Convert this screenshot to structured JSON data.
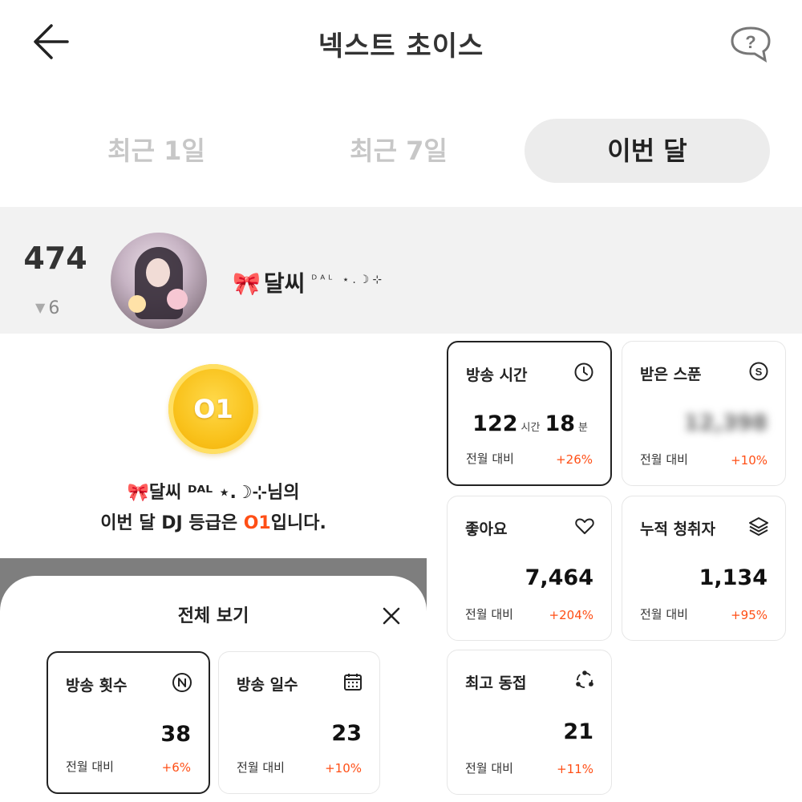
{
  "header": {
    "title": "넥스트 초이스",
    "back_icon": "arrow-left-icon",
    "help_icon": "question-bubble-icon"
  },
  "tabs": [
    {
      "label": "최근 1일",
      "active": false
    },
    {
      "label": "최근 7일",
      "active": false
    },
    {
      "label": "이번 달",
      "active": true
    }
  ],
  "profile": {
    "rank": "474",
    "rank_change": "6",
    "rank_change_direction": "down",
    "name": "달씨",
    "name_decoration": "ᴰᴬᴸ ⋆.☽⊹",
    "ribbon": "🎀"
  },
  "summary": {
    "medal_label": "O1",
    "line1": "🎀달씨 ᴰᴬᴸ ⋆.☽⊹님의",
    "line2_prefix": "이번 달 DJ 등급은 ",
    "line2_grade": "O1",
    "line2_suffix": "입니다."
  },
  "colors": {
    "accent": "#ff4f16",
    "tab_active_bg": "#ececec",
    "tab_inactive_text": "#c7c7c7",
    "profile_band_bg": "#f2f2f2",
    "medal_gold": "#f9c21c"
  },
  "cards": {
    "broadcast_time": {
      "title": "방송 시간",
      "icon": "clock-icon",
      "hours": "122",
      "hours_unit": "시간",
      "minutes": "18",
      "minutes_unit": "분",
      "cmp_label": "전월 대비",
      "cmp_value": "+26%"
    },
    "spoons": {
      "title": "받은 스푼",
      "icon": "spoon-coin-icon",
      "value": "12,398",
      "value_hidden": true,
      "cmp_label": "전월 대비",
      "cmp_value": "+10%"
    },
    "likes": {
      "title": "좋아요",
      "icon": "heart-icon",
      "value": "7,464",
      "cmp_label": "전월 대비",
      "cmp_value": "+204%"
    },
    "listeners": {
      "title": "누적 청취자",
      "icon": "layers-icon",
      "value": "1,134",
      "cmp_label": "전월 대비",
      "cmp_value": "+95%"
    },
    "peak_concurrent": {
      "title": "최고 동접",
      "icon": "share-nodes-icon",
      "value": "21",
      "cmp_label": "전월 대비",
      "cmp_value": "+11%"
    }
  },
  "sheet": {
    "title": "전체 보기",
    "close_icon": "close-icon",
    "cards": {
      "broadcast_count": {
        "title": "방송 횟수",
        "icon": "n-circle-icon",
        "value": "38",
        "cmp_label": "전월 대비",
        "cmp_value": "+6%"
      },
      "broadcast_days": {
        "title": "방송 일수",
        "icon": "calendar-icon",
        "value": "23",
        "cmp_label": "전월 대비",
        "cmp_value": "+10%"
      }
    }
  }
}
